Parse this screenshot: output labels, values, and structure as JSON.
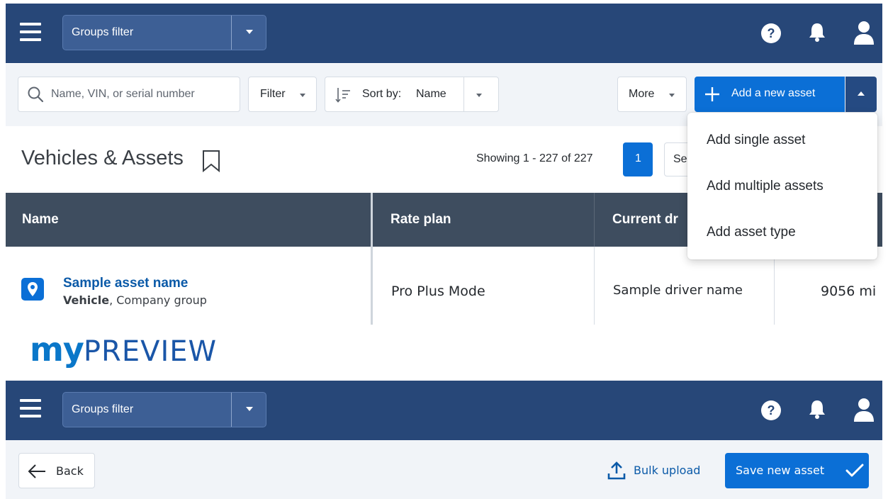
{
  "top_screen": {
    "navbar": {
      "groups_filter_label": "Groups filter"
    },
    "toolbar": {
      "search_placeholder": "Name, VIN, or serial number",
      "filter_label": "Filter",
      "sort_label": "Sort by:",
      "sort_value": "Name",
      "more_label": "More",
      "add_asset_label": "Add a new asset"
    },
    "heading": {
      "title": "Vehicles & Assets",
      "showing_text": "Showing 1 - 227 of 227",
      "current_page": "1",
      "partial_button_text": "Se"
    },
    "table": {
      "columns": [
        "Name",
        "Rate plan",
        "Current dr"
      ],
      "rows": [
        {
          "name": "Sample asset name",
          "type": "Vehicle",
          "group": ", Company group",
          "rate_plan": "Pro Plus Mode",
          "driver": "Sample driver name",
          "odometer": "9056 mi"
        }
      ]
    },
    "add_menu": {
      "items": [
        "Add single asset",
        "Add multiple assets",
        "Add asset type"
      ]
    }
  },
  "brand": {
    "logo_text_my": "my",
    "logo_text_preview": "PREVIEW",
    "colors": {
      "my": "#0a77c9",
      "preview": "#1a56a8"
    }
  },
  "bottom_screen": {
    "navbar": {
      "groups_filter_label": "Groups filter"
    },
    "toolbar": {
      "back_label": "Back",
      "bulk_upload_label": "Bulk upload",
      "save_label": "Save new asset"
    }
  },
  "colors": {
    "navbar": "#274778",
    "primary": "#0b6fd6",
    "table_header": "#3e4d5f",
    "link": "#0b5aa8"
  }
}
